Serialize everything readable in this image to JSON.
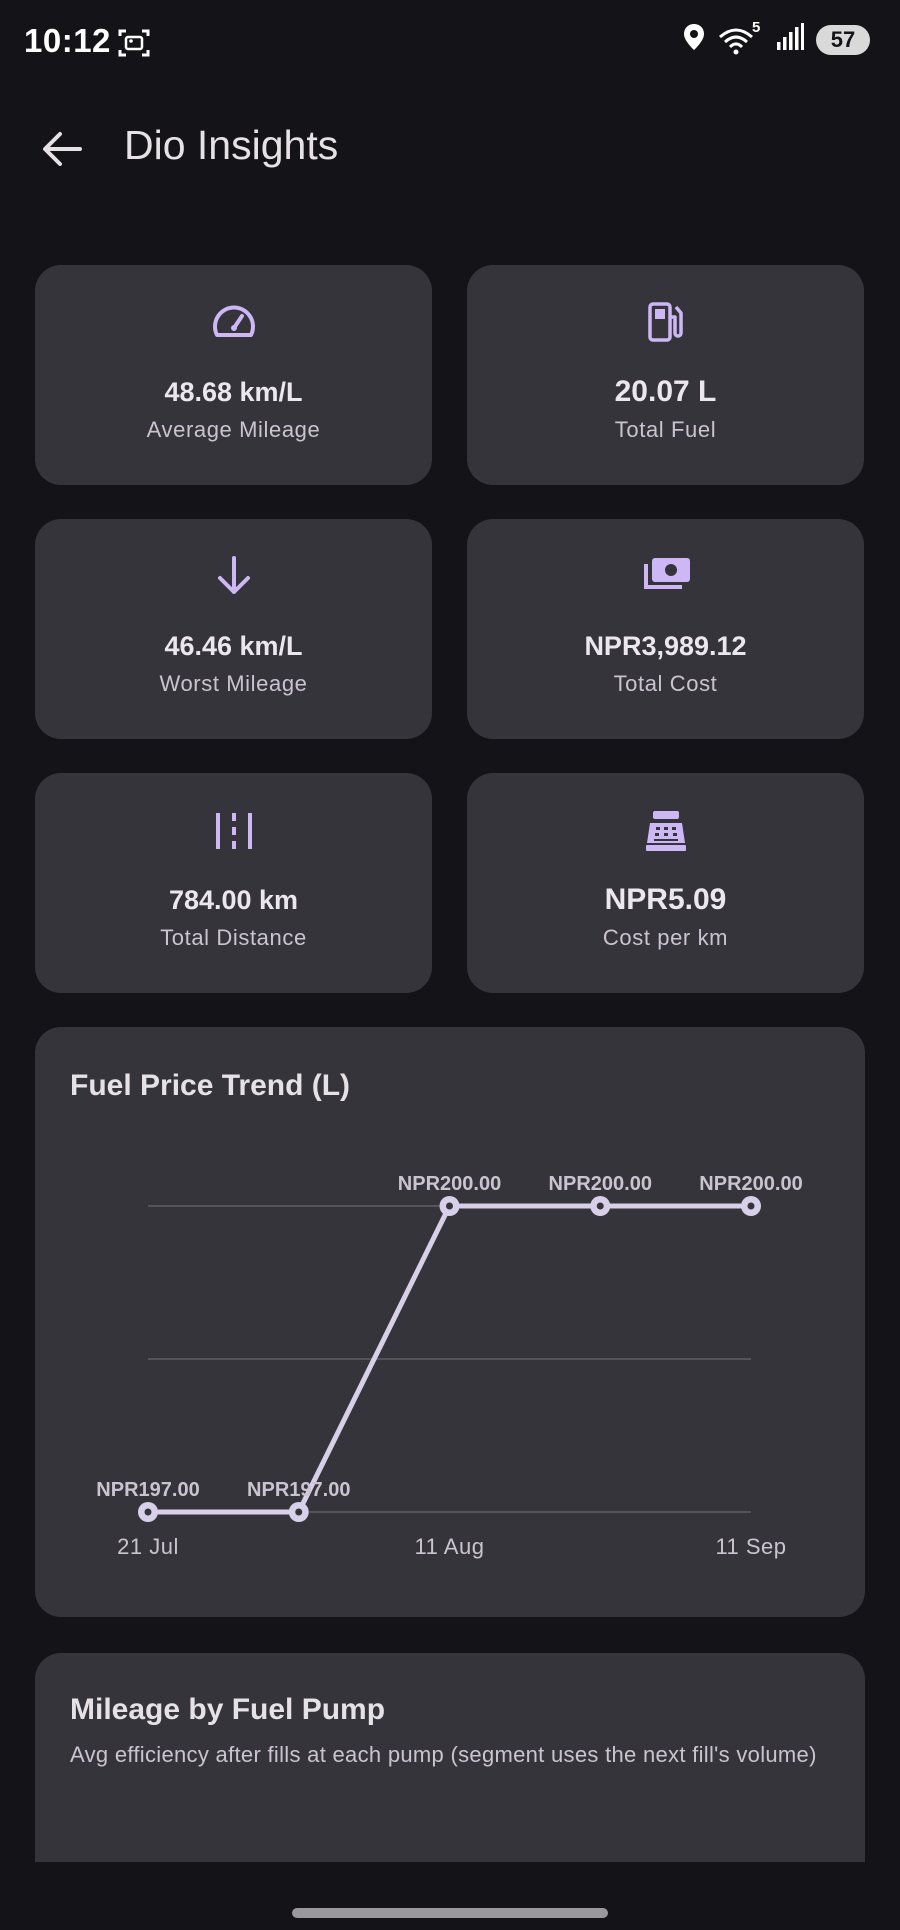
{
  "status_bar": {
    "time": "10:12",
    "wifi_badge": "5",
    "battery": "57"
  },
  "app_bar": {
    "title": "Dio Insights"
  },
  "stats": [
    {
      "icon": "speedometer-icon",
      "value": "48.68 km/L",
      "label": "Average Mileage"
    },
    {
      "icon": "fuel-pump-icon",
      "value": "20.07 L",
      "label": "Total Fuel"
    },
    {
      "icon": "arrow-down-icon",
      "value": "46.46 km/L",
      "label": "Worst Mileage"
    },
    {
      "icon": "money-icon",
      "value": "NPR3,989.12",
      "label": "Total Cost"
    },
    {
      "icon": "distance-icon",
      "value": "784.00 km",
      "label": "Total Distance"
    },
    {
      "icon": "cash-register-icon",
      "value": "NPR5.09",
      "label": "Cost per km"
    }
  ],
  "chart_data": {
    "type": "line",
    "title": "Fuel Price Trend (L)",
    "x_tick_labels": [
      "21 Jul",
      "11 Aug",
      "11 Sep"
    ],
    "series": [
      {
        "values": [
          197.0,
          197.0,
          200.0,
          200.0,
          200.0
        ],
        "data_labels": [
          "NPR197.00",
          "NPR197.00",
          "NPR200.00",
          "NPR200.00",
          "NPR200.00"
        ]
      }
    ],
    "ylim": [
      197,
      200
    ],
    "grid": true,
    "line_color": "#d8cfe8"
  },
  "pump_card": {
    "title": "Mileage by Fuel Pump",
    "subtitle": "Avg efficiency after fills at each pump (segment uses the next fill's volume)"
  },
  "colors": {
    "accent": "#cdb8f5",
    "card": "#36343b",
    "background": "#141317"
  }
}
